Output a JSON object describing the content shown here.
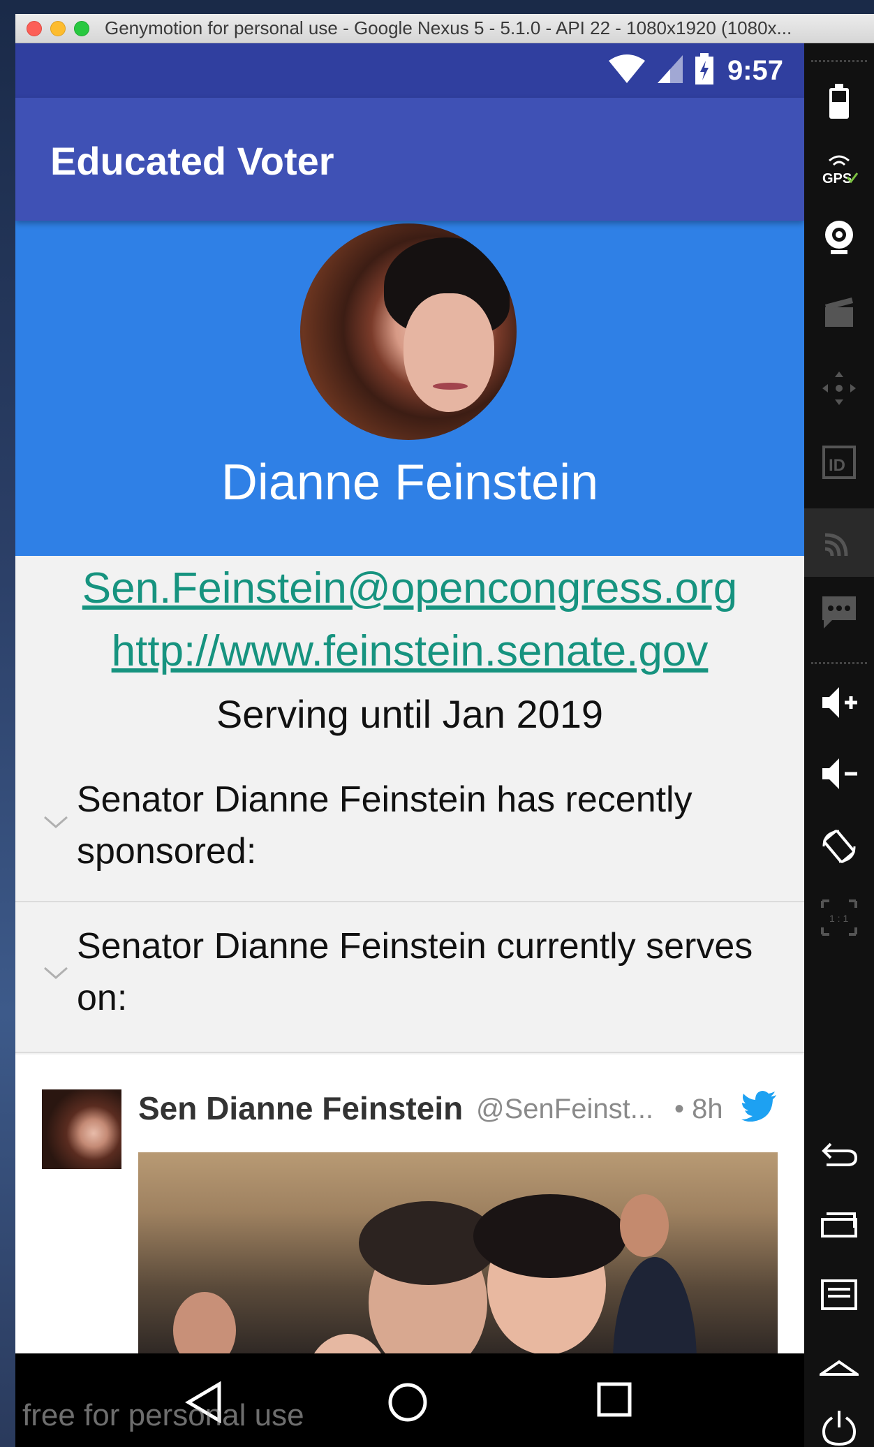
{
  "window": {
    "title": "Genymotion for personal use - Google Nexus 5 - 5.1.0 - API 22 - 1080x1920 (1080x..."
  },
  "status_bar": {
    "time": "9:57"
  },
  "app_bar": {
    "title": "Educated Voter"
  },
  "profile": {
    "name": "Dianne Feinstein"
  },
  "contact": {
    "email": "Sen.Feinstein@opencongress.org",
    "website": "http://www.feinstein.senate.gov",
    "serving": "Serving until Jan 2019"
  },
  "sections": [
    {
      "label": "Senator Dianne Feinstein has recently sponsored:"
    },
    {
      "label": "Senator Dianne Feinstein currently serves on:"
    }
  ],
  "tweet": {
    "author": "Sen Dianne Feinstein",
    "handle": "@SenFeinst...",
    "time": "• 8h"
  },
  "watermark": "free for personal use",
  "colors": {
    "status_bar": "#303f9f",
    "app_bar": "#3f51b5",
    "profile_bg": "#2f80e6",
    "link": "#16937f",
    "twitter": "#1da1f2"
  },
  "icons": {
    "status": [
      "wifi-icon",
      "signal-icon",
      "battery-charging-icon"
    ],
    "sidebar": [
      "battery-icon",
      "gps-icon",
      "webcam-icon",
      "capture-icon",
      "dpad-icon",
      "id-icon",
      "cast-icon",
      "sms-icon",
      "volume-up-icon",
      "volume-down-icon",
      "rotate-icon",
      "pixel-perfect-icon",
      "back-icon",
      "recent-apps-icon",
      "menu-icon",
      "home-icon",
      "power-icon"
    ],
    "nav": [
      "back-icon",
      "home-icon",
      "recents-icon"
    ]
  }
}
